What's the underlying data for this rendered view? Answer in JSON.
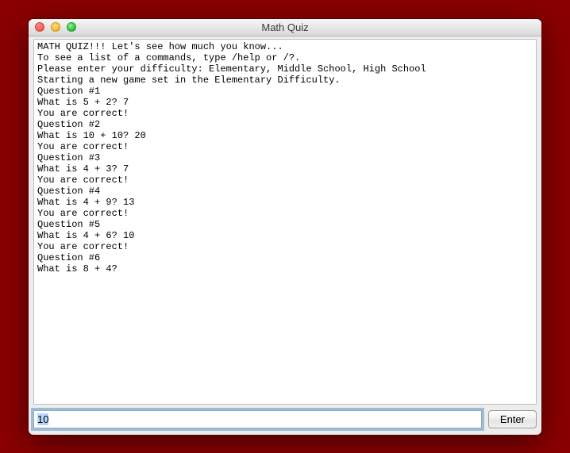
{
  "window": {
    "title": "Math Quiz"
  },
  "console": {
    "lines": [
      "MATH QUIZ!!! Let's see how much you know...",
      "To see a list of a commands, type /help or /?.",
      "Please enter your difficulty: Elementary, Middle School, High School",
      "Starting a new game set in the Elementary Difficulty.",
      "Question #1",
      "What is 5 + 2? 7",
      "You are correct!",
      "Question #2",
      "What is 10 + 10? 20",
      "You are correct!",
      "Question #3",
      "What is 4 + 3? 7",
      "You are correct!",
      "Question #4",
      "What is 4 + 9? 13",
      "You are correct!",
      "Question #5",
      "What is 4 + 6? 10",
      "You are correct!",
      "Question #6",
      "What is 8 + 4?"
    ]
  },
  "input": {
    "value": "10",
    "enter_label": "Enter"
  }
}
